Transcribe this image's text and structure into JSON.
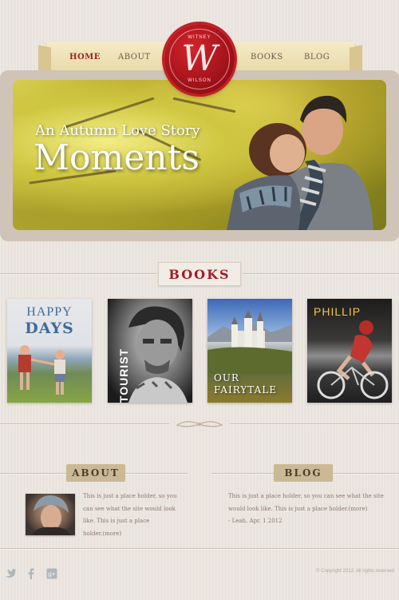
{
  "nav": {
    "home": "HOME",
    "about": "ABOUT",
    "books": "BOOKS",
    "blog": "BLOG"
  },
  "logo": {
    "top_text": "WITNEY",
    "letter": "W",
    "bottom_text": "WILSON"
  },
  "hero": {
    "subtitle": "An Autumn Love Story",
    "title": "Moments"
  },
  "books_section": {
    "heading": "BOOKS",
    "items": [
      {
        "title_line1": "HAPPY",
        "title_line2": "DAYS"
      },
      {
        "title": "TOURIST"
      },
      {
        "title_line1": "OUR",
        "title_line2": "FAIRYTALE"
      },
      {
        "title": "PHILLIP"
      }
    ]
  },
  "about": {
    "heading": "ABOUT",
    "text_line1": "This is just a place holder, so you",
    "text_line2": "can see what the site would look",
    "text_line3": "like. This is just a place",
    "text_line4": "holder.(more)"
  },
  "blog": {
    "heading": "BLOG",
    "text_line1": "This is just a place holder, so you can see what the site",
    "text_line2": "would look like. This is just a place holder.(more)",
    "meta": "- Leah, Apr. 1 2012"
  },
  "footer": {
    "copyright": "© Copyright 2012. All rights reserved",
    "social": [
      "twitter-icon",
      "facebook-icon",
      "google-plus-icon"
    ]
  },
  "colors": {
    "accent": "#a01d24",
    "background": "#e9e3dd",
    "tab_tan": "#cbb995"
  }
}
